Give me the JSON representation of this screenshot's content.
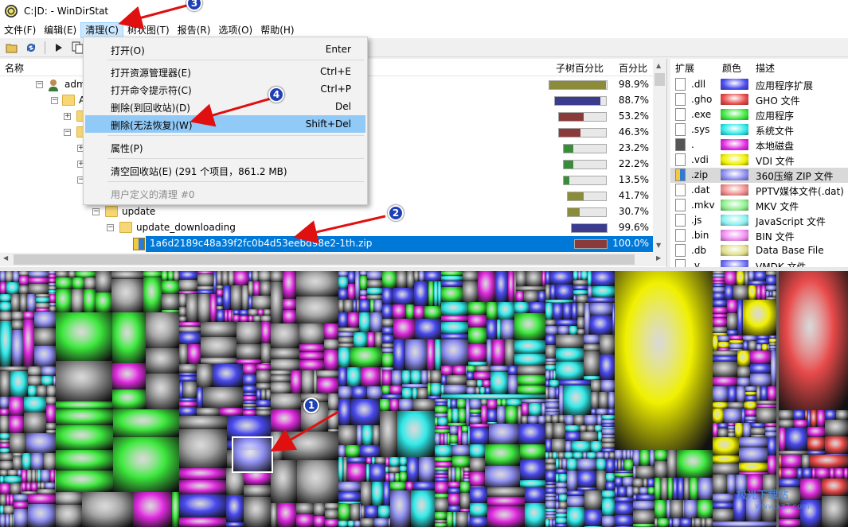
{
  "window": {
    "title": "C:|D: - WinDirStat"
  },
  "menubar": [
    {
      "label": "文件(F)",
      "name": "menu-file"
    },
    {
      "label": "编辑(E)",
      "name": "menu-edit"
    },
    {
      "label": "清理(C)",
      "name": "menu-cleanup",
      "active": true
    },
    {
      "label": "树状图(T)",
      "name": "menu-treemap"
    },
    {
      "label": "报告(R)",
      "name": "menu-report"
    },
    {
      "label": "选项(O)",
      "name": "menu-options"
    },
    {
      "label": "帮助(H)",
      "name": "menu-help"
    }
  ],
  "tree": {
    "headers": {
      "name": "名称",
      "subtree": "子树百分比",
      "percent": "百分比"
    },
    "rows": [
      {
        "name": "adm",
        "subtree_pct": 0.989,
        "percent": "98.9%",
        "bar_color": "#8b8b3a"
      },
      {
        "name": "A",
        "subtree_pct": 0.887,
        "percent": "88.7%",
        "bar_color": "#3b3b8f"
      },
      {
        "name": "",
        "subtree_pct": 0.532,
        "percent": "53.2%",
        "bar_color": "#8b3a3a"
      },
      {
        "name": "",
        "subtree_pct": 0.463,
        "percent": "46.3%",
        "bar_color": "#8b3a3a"
      },
      {
        "name": "",
        "subtree_pct": 0.232,
        "percent": "23.2%",
        "bar_color": "#3a8b3a"
      },
      {
        "name": "",
        "subtree_pct": 0.222,
        "percent": "22.2%",
        "bar_color": "#3a8b3a"
      },
      {
        "name": "",
        "subtree_pct": 0.135,
        "percent": "13.5%",
        "bar_color": "#3a8b3a"
      },
      {
        "name": "",
        "subtree_pct": 0.417,
        "percent": "41.7%",
        "bar_color": "#8b8b3a"
      },
      {
        "name": "update",
        "subtree_pct": 0.307,
        "percent": "30.7%",
        "bar_color": "#8b8b3a"
      },
      {
        "name": "update_downloading",
        "subtree_pct": 0.996,
        "percent": "99.6%",
        "bar_color": "#3b3b8f"
      },
      {
        "name": "1a6d2189c48a39f2fc0b4d53eebd98e2-1th.zip",
        "subtree_pct": 1.0,
        "percent": "100.0%",
        "bar_color": "#8b3a3a",
        "selected": true
      }
    ]
  },
  "extensions": {
    "headers": {
      "ext": "扩展",
      "color": "颜色",
      "desc": "描述"
    },
    "rows": [
      {
        "ext": ".dll",
        "color": "#4a4af0",
        "desc": "应用程序扩展"
      },
      {
        "ext": ".gho",
        "color": "#e84a4a",
        "desc": "GHO 文件"
      },
      {
        "ext": ".exe",
        "color": "#3ce83c",
        "desc": "应用程序"
      },
      {
        "ext": ".sys",
        "color": "#2ee8e8",
        "desc": "系统文件"
      },
      {
        "ext": ".",
        "color": "#e02ae0",
        "desc": "本地磁盘"
      },
      {
        "ext": ".vdi",
        "color": "#f0f000",
        "desc": "VDI 文件"
      },
      {
        "ext": ".zip",
        "color": "#8c8cf0",
        "desc": "360压缩 ZIP 文件",
        "highlight": true
      },
      {
        "ext": ".dat",
        "color": "#f08c8c",
        "desc": "PPTV媒体文件(.dat)"
      },
      {
        "ext": ".mkv",
        "color": "#8cf08c",
        "desc": "MKV 文件"
      },
      {
        "ext": ".js",
        "color": "#8cf0f0",
        "desc": "JavaScript 文件"
      },
      {
        "ext": ".bin",
        "color": "#f08cf0",
        "desc": "BIN 文件"
      },
      {
        "ext": ".db",
        "color": "#e0e08c",
        "desc": "Data Base File"
      },
      {
        "ext": ".v",
        "color": "#6a6af0",
        "desc": "VMDK 文件"
      }
    ]
  },
  "cleanup_menu": [
    {
      "label": "打开(O)",
      "shortcut": "Enter",
      "name": "menu-open"
    },
    {
      "label": "打开资源管理器(E)",
      "shortcut": "Ctrl+E",
      "name": "menu-open-explorer"
    },
    {
      "label": "打开命令提示符(C)",
      "shortcut": "Ctrl+P",
      "name": "menu-open-cmd"
    },
    {
      "label": "删除(到回收站)(D)",
      "shortcut": "Del",
      "name": "menu-delete-recycle"
    },
    {
      "label": "删除(无法恢复)(W)",
      "shortcut": "Shift+Del",
      "name": "menu-delete-permanent",
      "hover": true
    },
    {
      "label": "属性(P)",
      "shortcut": "",
      "name": "menu-properties"
    },
    {
      "label": "清空回收站(E) (291 个项目，861.2 MB)",
      "shortcut": "",
      "name": "menu-empty-recycle"
    },
    {
      "label": "用户定义的清理 #0",
      "shortcut": "",
      "name": "menu-user-cleanup",
      "disabled": true
    }
  ],
  "badges": [
    "1",
    "2",
    "3",
    "4"
  ],
  "watermark": {
    "line1": "极光下载站",
    "line2": "www.xz7.com"
  },
  "colors": {
    "accent": "#0078d7",
    "arrow": "#e01010",
    "badge": "#1f3fb5"
  }
}
